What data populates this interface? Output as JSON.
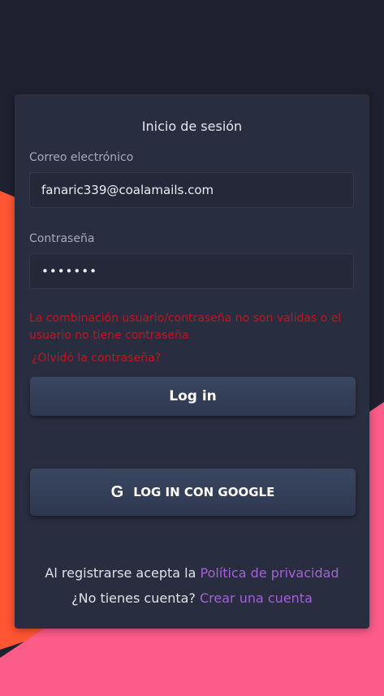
{
  "colors": {
    "background": "#1f2130",
    "accent_orange": "#fe5533",
    "accent_pink": "#fb5c88",
    "card": "#292d40",
    "error": "#c4141d",
    "link": "#a460d8"
  },
  "login": {
    "title": "Inicio de sesión",
    "email_label": "Correo electrónico",
    "email_value": "fanaric339@coalamails.com",
    "password_label": "Contraseña",
    "password_value": "•••••••",
    "error_message": "La combinación usuario/contraseña no son validas o el usuario no tiene contraseña",
    "forgot_password": "¿Olvidó la contraseña?",
    "login_button": "Log in",
    "google_icon": "G",
    "google_button": "LOG IN CON GOOGLE"
  },
  "footer": {
    "terms_prefix": "Al registrarse acepta la",
    "privacy_link": "Política de privacidad",
    "no_account": "¿No tienes cuenta?",
    "create_account_link": "Crear una cuenta"
  }
}
